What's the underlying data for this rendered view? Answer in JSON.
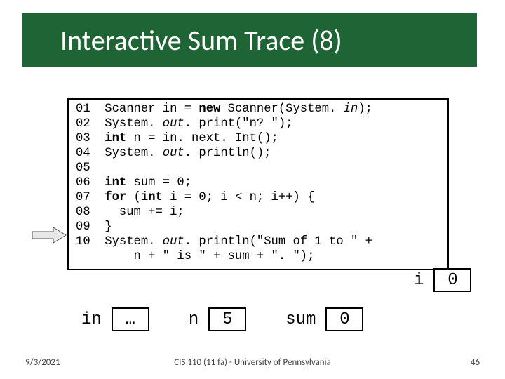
{
  "title": "Interactive Sum Trace (8)",
  "code": {
    "lines": [
      {
        "ln": "01",
        "pre": "Scanner in = ",
        "kw": "new",
        "mid": " Scanner(System. ",
        "it": "in",
        "post": ");"
      },
      {
        "ln": "02",
        "pre": "System. ",
        "it": "out",
        "post": ". print(\"n? \");"
      },
      {
        "ln": "03",
        "pre": "",
        "kw": "int",
        "post": " n = in. next. Int();"
      },
      {
        "ln": "04",
        "pre": "System. ",
        "it": "out",
        "post": ". println();"
      },
      {
        "ln": "05",
        "pre": ""
      },
      {
        "ln": "06",
        "pre": "",
        "kw": "int",
        "post": " sum = 0;"
      },
      {
        "ln": "07",
        "pre": "",
        "kw": "for",
        "mid": " (",
        "kw2": "int",
        "post": " i = 0; i < n; i++) {"
      },
      {
        "ln": "08",
        "pre": "  sum += i;"
      },
      {
        "ln": "09",
        "pre": "}"
      },
      {
        "ln": "10",
        "pre": "System. ",
        "it": "out",
        "post": ". println(\"Sum of 1 to \" +"
      },
      {
        "ln": "  ",
        "pre": "    n + \" is \" + sum + \". \");"
      }
    ]
  },
  "vars": {
    "i_label": "i",
    "i_value": "0",
    "in_label": "in",
    "in_value": "…",
    "n_label": "n",
    "n_value": "5",
    "sum_label": "sum",
    "sum_value": "0"
  },
  "footer": {
    "date": "9/3/2021",
    "center": "CIS 110 (11 fa) - University of Pennsylvania",
    "page": "46"
  }
}
